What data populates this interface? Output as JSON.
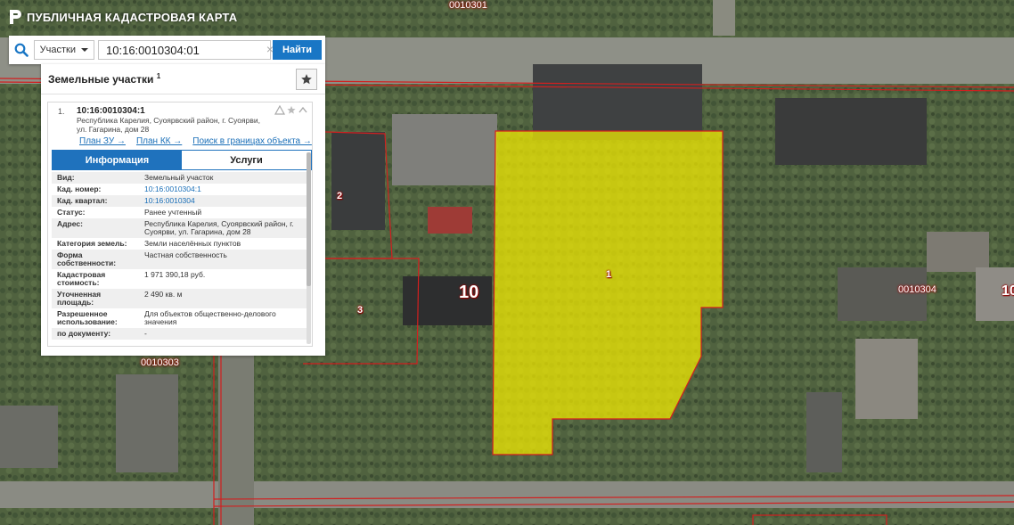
{
  "app": {
    "title": "ПУБЛИЧНАЯ КАДАСТРОВАЯ КАРТА"
  },
  "search": {
    "type_selected": "Участки",
    "value": "10:16:0010304:01",
    "clear_glyph": "×",
    "button_label": "Найти"
  },
  "panel": {
    "title": "Земельные участки",
    "count": "1",
    "item": {
      "index": "1.",
      "number": "10:16:0010304:1",
      "address": "Республика Карелия, Суоярвский район, г. Суоярви, ул. Гагарина, дом 28",
      "links": [
        "План ЗУ →",
        "План КК →",
        "Поиск в границах объекта →"
      ]
    },
    "tabs": {
      "info": "Информация",
      "services": "Услуги",
      "active": "info"
    },
    "attributes": [
      {
        "key": "Вид:",
        "value": "Земельный участок",
        "link": false
      },
      {
        "key": "Кад. номер:",
        "value": "10:16:0010304:1",
        "link": true
      },
      {
        "key": "Кад. квартал:",
        "value": "10:16:0010304",
        "link": true
      },
      {
        "key": "Статус:",
        "value": "Ранее учтенный",
        "link": false
      },
      {
        "key": "Адрес:",
        "value": "Республика Карелия, Суоярвский район, г. Суоярви, ул. Гагарина, дом 28",
        "link": false
      },
      {
        "key": "Категория земель:",
        "value": "Земли населённых пунктов",
        "link": false
      },
      {
        "key": "Форма собственности:",
        "value": "Частная собственность",
        "link": false
      },
      {
        "key": "Кадастровая стоимость:",
        "value": "1 971 390,18 руб.",
        "link": false
      },
      {
        "key": "Уточненная площадь:",
        "value": "2 490 кв. м",
        "link": false
      },
      {
        "key": "Разрешенное использование:",
        "value": "Для объектов общественно-делового значения",
        "link": false
      },
      {
        "key": "по документу:",
        "value": "-",
        "link": false
      }
    ]
  },
  "map": {
    "quarter_labels": [
      "0010301",
      "0010303",
      "0010304"
    ],
    "edge_label": "10",
    "big_label": "10",
    "parcel_labels": [
      "1",
      "2",
      "3"
    ]
  },
  "colors": {
    "accent": "#1976c5",
    "parcel_fill": "#f5ee00",
    "boundary": "#d21f1f"
  }
}
